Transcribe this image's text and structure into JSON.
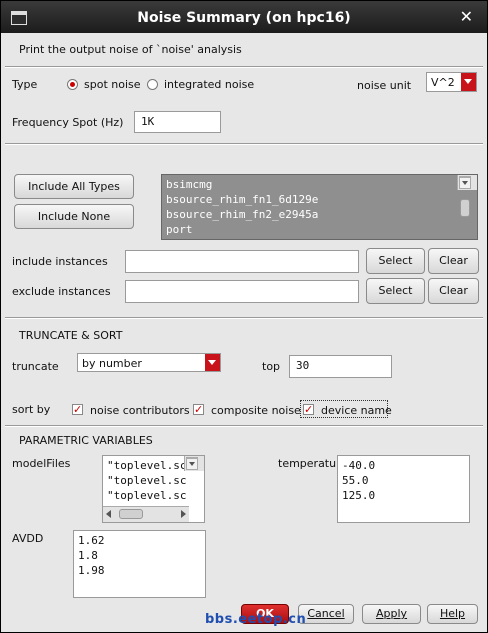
{
  "window": {
    "title": "Noise Summary (on hpc16)"
  },
  "intro": "Print the output noise of `noise' analysis",
  "type_row": {
    "label": "Type",
    "options": [
      "spot noise",
      "integrated noise"
    ],
    "selected": "spot noise",
    "noise_unit_label": "noise unit",
    "noise_unit_value": "V^2"
  },
  "frequency_spot": {
    "label": "Frequency Spot (Hz)",
    "value": "1K"
  },
  "include_buttons": {
    "include_all": "Include All Types",
    "include_none": "Include None"
  },
  "types_list": [
    "bsimcmg",
    "bsource_rhim_fn1_6d129e",
    "bsource_rhim_fn2_e2945a",
    "port"
  ],
  "include_instances": {
    "label": "include instances",
    "value": "",
    "select": "Select",
    "clear": "Clear"
  },
  "exclude_instances": {
    "label": "exclude instances",
    "value": "",
    "select": "Select",
    "clear": "Clear"
  },
  "truncate_sort": {
    "heading": "TRUNCATE & SORT",
    "truncate_label": "truncate",
    "truncate_value": "by number",
    "top_label": "top",
    "top_value": "30",
    "sort_label": "sort by",
    "sort_options": [
      {
        "label": "noise contributors",
        "checked": true
      },
      {
        "label": "composite noise",
        "checked": true
      },
      {
        "label": "device name",
        "checked": true
      }
    ]
  },
  "parametric": {
    "heading": "PARAMETRIC VARIABLES",
    "modelFiles_label": "modelFiles",
    "modelFiles_values": [
      "\"toplevel.sc",
      "\"toplevel.sc",
      "\"toplevel.sc"
    ],
    "temperature_label": "temperatur",
    "temperature_values": [
      "-40.0",
      "55.0",
      "125.0"
    ],
    "avdd_label": "AVDD",
    "avdd_values": [
      "1.62",
      "1.8",
      "1.98"
    ]
  },
  "footer": {
    "ok": "OK",
    "cancel": "Cancel",
    "apply": "Apply",
    "help": "Help"
  },
  "watermark": "bbs.eetop.cn",
  "colors": {
    "accent": "#c9131b",
    "list_bg": "#8f8f8f",
    "titlebar": "#262626"
  }
}
